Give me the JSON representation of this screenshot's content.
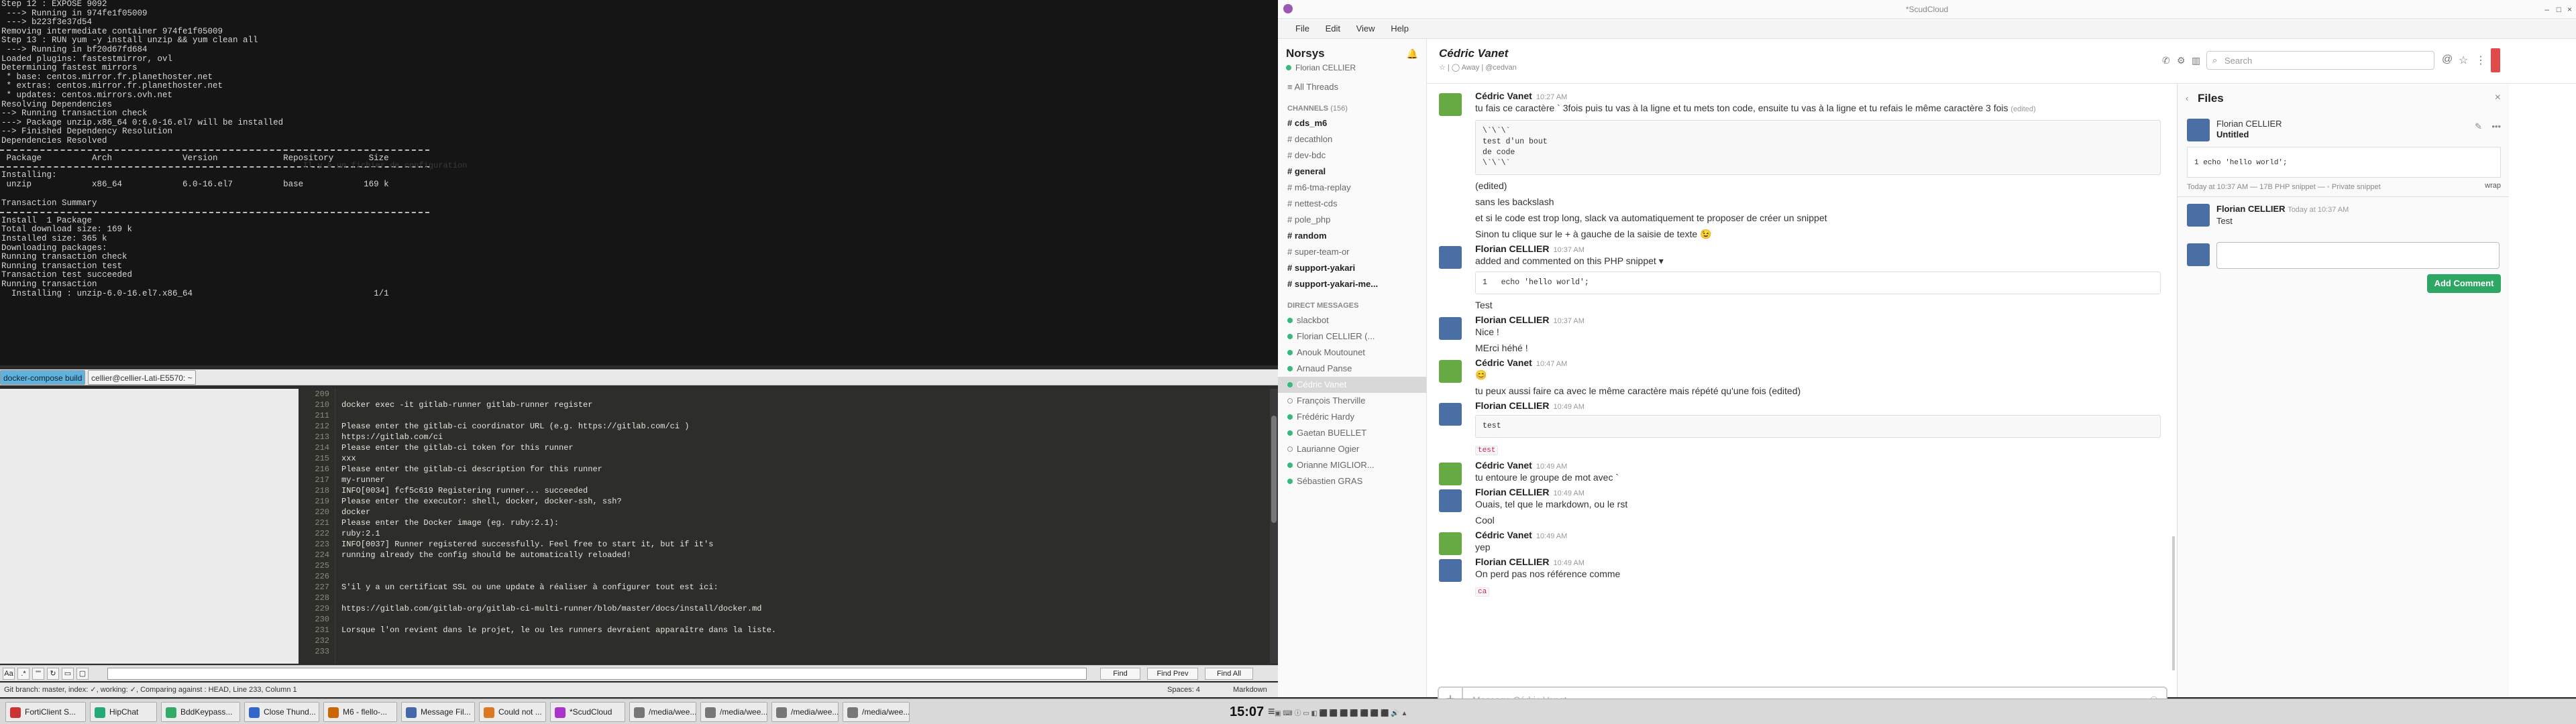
{
  "terminal": {
    "lines": [
      "Step 12 : EXPOSE 9092",
      " ---> Running in 974fe1f05009",
      " ---> b223f3e37d54",
      "Removing intermediate container 974fe1f05009",
      "Step 13 : RUN yum -y install unzip && yum clean all",
      " ---> Running in bf20d67fd684",
      "Loaded plugins: fastestmirror, ovl",
      "Determining fastest mirrors",
      " * base: centos.mirror.fr.planethoster.net",
      " * extras: centos.mirror.fr.planethoster.net",
      " * updates: centos.mirrors.ovh.net",
      "Resolving Dependencies",
      "--> Running transaction check",
      "---> Package unzip.x86_64 0:6.0-16.el7 will be installed",
      "--> Finished Dependency Resolution",
      "",
      "Dependencies Resolved"
    ],
    "table_header": " Package          Arch              Version             Repository       Size",
    "lines2": [
      "Installing:",
      " unzip            x86_64            6.0-16.el7          base            169 k"
    ],
    "lines3": [
      "Transaction Summary"
    ],
    "lines4": [
      "Install  1 Package",
      "",
      "Total download size: 169 k",
      "Installed size: 365 k",
      "Downloading packages:",
      "Running transaction check",
      "Running transaction test",
      "Transaction test succeeded",
      "Running transaction",
      "  Installing : unzip-6.0-16.el7.x86_64                                    1/1"
    ]
  },
  "terminal_tabs": [
    "docker-compose build",
    "cellier@cellier-Lati-E5570: ~"
  ],
  "editor": {
    "line_numbers": [
      "209",
      "210",
      "211",
      "212",
      "213",
      "214",
      "215",
      "216",
      "217",
      "218",
      "219",
      "220",
      "221",
      "222",
      "223",
      "224",
      "225",
      "226",
      "227",
      "228",
      "229",
      "230",
      "231",
      "232",
      "233"
    ],
    "lines": [
      "",
      "docker exec -it gitlab-runner gitlab-runner register",
      "",
      "Please enter the gitlab-ci coordinator URL (e.g. https://gitlab.com/ci )",
      "https://gitlab.com/ci",
      "Please enter the gitlab-ci token for this runner",
      "xxx",
      "Please enter the gitlab-ci description for this runner",
      "my-runner",
      "INFO[0034] fcf5c619 Registering runner... succeeded",
      "Please enter the executor: shell, docker, docker-ssh, ssh?",
      "docker",
      "Please enter the Docker image (eg. ruby:2.1):",
      "ruby:2.1",
      "INFO[0037] Runner registered successfully. Feel free to start it, but if it's",
      "running already the config should be automatically reloaded!",
      "",
      "",
      "S'il y a un certificat SSL ou une update à réaliser à configurer tout est ici:",
      "",
      "https://gitlab.com/gitlab-org/gitlab-ci-multi-runner/blob/master/docs/install/docker.md",
      "",
      "Lorsque l'on revient dans le projet, le ou les runners devraient apparaître dans la liste.",
      "",
      ""
    ]
  },
  "findbar": {
    "find": "Find",
    "find_prev": "Find Prev",
    "find_all": "Find All"
  },
  "statusbar": {
    "left": "Git branch: master, index: ✓, working: ✓, Comparing against : HEAD, Line 233, Column 1",
    "spaces": "Spaces: 4",
    "syntax": "Markdown"
  },
  "taskbar": {
    "items": [
      "FortiClient S...",
      "HipChat",
      "BddKeypass...",
      "Close Thund...",
      "M6 - flello-...",
      "Message Fil...",
      "Could not ...",
      "*ScudCloud",
      "/media/wee...",
      "/media/wee...",
      "/media/wee...",
      "/media/wee..."
    ],
    "clock": "15:07"
  },
  "slack": {
    "window_title": "*ScudCloud",
    "menu": [
      "File",
      "Edit",
      "View",
      "Help"
    ],
    "team": "Norsys",
    "user": "Florian CELLIER",
    "all_threads": "All Threads",
    "channels_header": "CHANNELS",
    "channels_count": "(156)",
    "channels": [
      {
        "name": "cds_m6",
        "bold": true
      },
      {
        "name": "decathlon",
        "bold": false
      },
      {
        "name": "dev-bdc",
        "bold": false
      },
      {
        "name": "general",
        "bold": true
      },
      {
        "name": "m6-tma-replay",
        "bold": false
      },
      {
        "name": "nettest-cds",
        "bold": false
      },
      {
        "name": "pole_php",
        "bold": false
      },
      {
        "name": "random",
        "bold": true
      },
      {
        "name": "super-team-or",
        "bold": false
      },
      {
        "name": "support-yakari",
        "bold": true
      },
      {
        "name": "support-yakari-me...",
        "bold": true
      }
    ],
    "dm_header": "DIRECT MESSAGES",
    "dms": [
      {
        "name": "slackbot",
        "on": true
      },
      {
        "name": "Florian CELLIER (...",
        "on": true
      },
      {
        "name": "Anouk Moutounet",
        "on": true
      },
      {
        "name": "Arnaud Panse",
        "on": true
      },
      {
        "name": "Cédric Vanet",
        "on": true,
        "sel": true
      },
      {
        "name": "François Therville",
        "on": false
      },
      {
        "name": "Frédéric Hardy",
        "on": true
      },
      {
        "name": "Gaetan BUELLET",
        "on": true
      },
      {
        "name": "Laurianne Ogier",
        "on": false
      },
      {
        "name": "Orianne MIGLIOR...",
        "on": true
      },
      {
        "name": "Sébastien GRAS",
        "on": true
      }
    ],
    "channel_title": "Cédric Vanet",
    "channel_sub": "☆ | ◯ Away | @cedvan",
    "messages": [
      {
        "name": "Cédric Vanet",
        "time": "10:27 AM",
        "text": "tu fais ce caractère ` 3fois puis tu vas à la ligne et tu mets ton code, ensuite tu vas à la ligne et tu refais le même caractère 3 fois",
        "edited": "(edited)",
        "code": "\\`\\`\\`\ntest d'un bout\nde code\n\\`\\`\\`",
        "after": [
          "(edited)",
          "sans les backslash",
          "et si le code est trop long, slack va automatiquement te proposer de créer un snippet",
          "Sinon tu clique sur le + à gauche de la saisie de texte 😉"
        ]
      },
      {
        "name": "Florian CELLIER",
        "time": "10:37 AM",
        "text": "added and commented on this PHP snippet ▾",
        "snippet": "1   echo 'hello world';",
        "after": [
          "Test"
        ]
      },
      {
        "name": "Florian CELLIER",
        "time": "10:37 AM",
        "text": "Nice !",
        "after": [
          "MErci héhé !"
        ]
      },
      {
        "name": "Cédric Vanet",
        "time": "10:47 AM",
        "text": "😊",
        "after": [
          "tu peux aussi faire ca avec le même caractère mais répété qu'une fois (edited)"
        ]
      },
      {
        "name": "Florian CELLIER",
        "time": "10:49 AM",
        "code": "test",
        "after": [
          "test"
        ]
      },
      {
        "name": "Cédric Vanet",
        "time": "10:49 AM",
        "text": "tu entoure le groupe de mot avec `"
      },
      {
        "name": "Florian CELLIER",
        "time": "10:49 AM",
        "text": "Ouais, tel que le markdown, ou le rst",
        "after": [
          "Cool"
        ]
      },
      {
        "name": "Cédric Vanet",
        "time": "10:49 AM",
        "text": "yep"
      },
      {
        "name": "Florian CELLIER",
        "time": "10:49 AM",
        "text": "On perd pas nos référence comme",
        "after": [
          "ca"
        ]
      }
    ],
    "input_placeholder": "Message Cédric Vanet",
    "search_placeholder": "Search",
    "files": {
      "title": "Files",
      "author": "Florian CELLIER",
      "file_title": "Untitled",
      "code": "1   echo 'hello world';",
      "meta": "Today at 10:37 AM — 17B PHP snippet — ◦ Private snippet",
      "wrap": "wrap",
      "comment_author": "Florian CELLIER",
      "comment_time": "Today at 10:37 AM",
      "comment_text": "Test",
      "add_comment": "Add Comment"
    }
  }
}
